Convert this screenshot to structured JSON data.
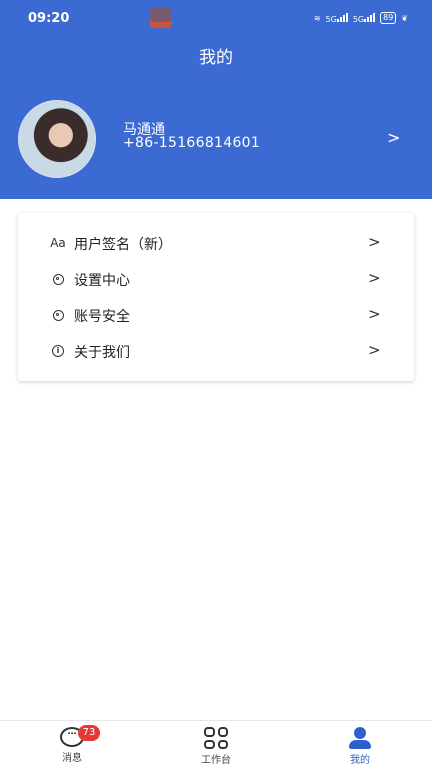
{
  "status_bar": {
    "time": "09:20",
    "net_label_1": "5G",
    "net_label_2": "5G",
    "battery": "89"
  },
  "header": {
    "title": "我的"
  },
  "profile": {
    "name": "马通通",
    "phone": "+86-15166814601"
  },
  "menu": {
    "items": [
      {
        "icon": "font-size-icon",
        "icon_text": "Aa",
        "label": "用户签名（新）"
      },
      {
        "icon": "gear-icon",
        "label": "设置中心"
      },
      {
        "icon": "gear-icon",
        "label": "账号安全"
      },
      {
        "icon": "info-icon",
        "label": "关于我们"
      }
    ]
  },
  "tabbar": {
    "tabs": [
      {
        "label": "消息",
        "icon": "message-icon",
        "badge": "73"
      },
      {
        "label": "工作台",
        "icon": "grid-icon"
      },
      {
        "label": "我的",
        "icon": "user-icon",
        "active": true
      }
    ]
  },
  "colors": {
    "header_bg": "#3b6ad3",
    "active_tab": "#2e5fcf",
    "badge": "#e53935"
  }
}
